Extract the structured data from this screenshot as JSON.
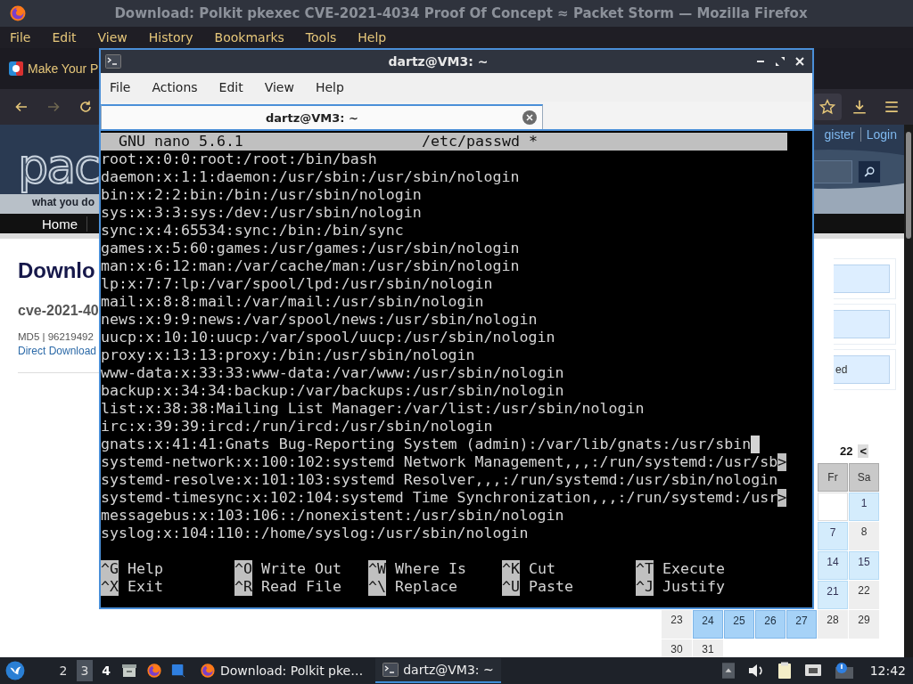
{
  "firefox": {
    "title": "Download: Polkit pkexec CVE-2021-4034 Proof Of Concept ≈ Packet Storm — Mozilla Firefox",
    "menu": [
      "File",
      "Edit",
      "View",
      "History",
      "Bookmarks",
      "Tools",
      "Help"
    ],
    "bookmarks": [
      {
        "label": "Make Your P"
      }
    ],
    "nav_buttons": [
      {
        "kind": "back",
        "disabled": false
      },
      {
        "kind": "forward",
        "disabled": true
      },
      {
        "kind": "reload",
        "disabled": false
      }
    ],
    "toolbar_buttons": [
      {
        "kind": "star"
      },
      {
        "kind": "download"
      },
      {
        "kind": "menu"
      }
    ],
    "page": {
      "logo": "pac",
      "tagline": "what you do",
      "account_links": [
        "gister",
        "Login"
      ],
      "nav": [
        "Home"
      ],
      "heading": "Downlo",
      "file_name": "cve-2021-40",
      "md5": "MD5 | 96219492",
      "download_link": "Direct Download",
      "side_boxes": [
        {
          "kind": "empty"
        },
        {
          "kind": "empty"
        },
        {
          "kind": "text",
          "text": "ed"
        }
      ],
      "calendar": {
        "title": "22",
        "nav": "<",
        "weekdays": [
          "Fr",
          "Sa"
        ],
        "days": [
          {
            "day": "1",
            "has_entries": true,
            "selected": false
          },
          {
            "day": "7",
            "has_entries": true,
            "selected": false
          },
          {
            "day": "8",
            "has_entries": false,
            "selected": false
          },
          {
            "day": "14",
            "has_entries": true,
            "selected": false
          },
          {
            "day": "15",
            "has_entries": true,
            "selected": false
          },
          {
            "day": "21",
            "has_entries": true,
            "selected": false
          },
          {
            "day": "22",
            "has_entries": false,
            "selected": false
          },
          {
            "day": "23",
            "has_entries": false,
            "selected": false
          },
          {
            "day": "24",
            "has_entries": false,
            "selected": true
          },
          {
            "day": "25",
            "has_entries": false,
            "selected": true
          },
          {
            "day": "26",
            "has_entries": false,
            "selected": true
          },
          {
            "day": "27",
            "has_entries": false,
            "selected": true
          },
          {
            "day": "28",
            "has_entries": false,
            "selected": false
          },
          {
            "day": "29",
            "has_entries": false,
            "selected": false
          },
          {
            "day": "30",
            "has_entries": false,
            "selected": false
          },
          {
            "day": "31",
            "has_entries": false,
            "selected": false
          }
        ]
      }
    }
  },
  "terminal": {
    "title": "dartz@VM3: ~",
    "menu": [
      "File",
      "Actions",
      "Edit",
      "View",
      "Help"
    ],
    "tabs": [
      {
        "label": "dartz@VM3: ~",
        "selected": true
      }
    ],
    "nano": {
      "version": "GNU nano 5.6.1",
      "file": "/etc/passwd *",
      "lines": [
        {
          "text": "root:x:0:0:root:/root:/bin/bash",
          "cursor": false
        },
        {
          "text": "daemon:x:1:1:daemon:/usr/sbin:/usr/sbin/nologin",
          "cursor": false
        },
        {
          "text": "bin:x:2:2:bin:/bin:/usr/sbin/nologin",
          "cursor": false
        },
        {
          "text": "sys:x:3:3:sys:/dev:/usr/sbin/nologin",
          "cursor": false
        },
        {
          "text": "sync:x:4:65534:sync:/bin:/bin/sync",
          "cursor": false
        },
        {
          "text": "games:x:5:60:games:/usr/games:/usr/sbin/nologin",
          "cursor": false
        },
        {
          "text": "man:x:6:12:man:/var/cache/man:/usr/sbin/nologin",
          "cursor": false
        },
        {
          "text": "lp:x:7:7:lp:/var/spool/lpd:/usr/sbin/nologin",
          "cursor": false
        },
        {
          "text": "mail:x:8:8:mail:/var/mail:/usr/sbin/nologin",
          "cursor": false
        },
        {
          "text": "news:x:9:9:news:/var/spool/news:/usr/sbin/nologin",
          "cursor": false
        },
        {
          "text": "uucp:x:10:10:uucp:/var/spool/uucp:/usr/sbin/nologin",
          "cursor": false
        },
        {
          "text": "proxy:x:13:13:proxy:/bin:/usr/sbin/nologin",
          "cursor": false
        },
        {
          "text": "www-data:x:33:33:www-data:/var/www:/usr/sbin/nologin",
          "cursor": false
        },
        {
          "text": "backup:x:34:34:backup:/var/backups:/usr/sbin/nologin",
          "cursor": false
        },
        {
          "text": "list:x:38:38:Mailing List Manager:/var/list:/usr/sbin/nologin",
          "cursor": false
        },
        {
          "text": "irc:x:39:39:ircd:/run/ircd:/usr/sbin/nologin",
          "cursor": false
        },
        {
          "text": "gnats:x:41:41:Gnats Bug-Reporting System (admin):/var/lib/gnats:/usr/sbin",
          "cursor": true
        },
        {
          "text": "systemd-network:x:100:102:systemd Network Management,,,:/run/systemd:/usr/sb",
          "more": ">",
          "cursor": false
        },
        {
          "text": "systemd-resolve:x:101:103:systemd Resolver,,,:/run/systemd:/usr/sbin/nologin",
          "cursor": false
        },
        {
          "text": "systemd-timesync:x:102:104:systemd Time Synchronization,,,:/run/systemd:/usr",
          "more": ">",
          "cursor": false
        },
        {
          "text": "messagebus:x:103:106::/nonexistent:/usr/sbin/nologin",
          "cursor": false
        },
        {
          "text": "syslog:x:104:110::/home/syslog:/usr/sbin/nologin",
          "cursor": false
        }
      ],
      "shortcuts": [
        [
          {
            "key": "^G",
            "label": "Help"
          },
          {
            "key": "^O",
            "label": "Write Out"
          },
          {
            "key": "^W",
            "label": "Where Is"
          },
          {
            "key": "^K",
            "label": "Cut"
          },
          {
            "key": "^T",
            "label": "Execute"
          }
        ],
        [
          {
            "key": "^X",
            "label": "Exit"
          },
          {
            "key": "^R",
            "label": "Read File"
          },
          {
            "key": "^\\",
            "label": "Replace"
          },
          {
            "key": "^U",
            "label": "Paste"
          },
          {
            "key": "^J",
            "label": "Justify"
          }
        ]
      ]
    }
  },
  "taskbar": {
    "workspaces": [
      {
        "label": "2",
        "selected": false,
        "current": false
      },
      {
        "label": "3",
        "selected": true,
        "current": false
      },
      {
        "label": "4",
        "selected": false,
        "current": true
      }
    ],
    "launchers": [
      {
        "kind": "files"
      },
      {
        "kind": "firefox"
      },
      {
        "kind": "window"
      }
    ],
    "tasks": [
      {
        "kind": "firefox",
        "label": "Download: Polkit pke…",
        "active": false
      },
      {
        "kind": "terminal",
        "label": "dartz@VM3: ~",
        "active": true
      }
    ],
    "tray": [
      {
        "kind": "arrow"
      },
      {
        "kind": "volume"
      },
      {
        "kind": "clipboard"
      },
      {
        "kind": "network"
      },
      {
        "kind": "notification"
      }
    ],
    "clock": "12:42"
  }
}
